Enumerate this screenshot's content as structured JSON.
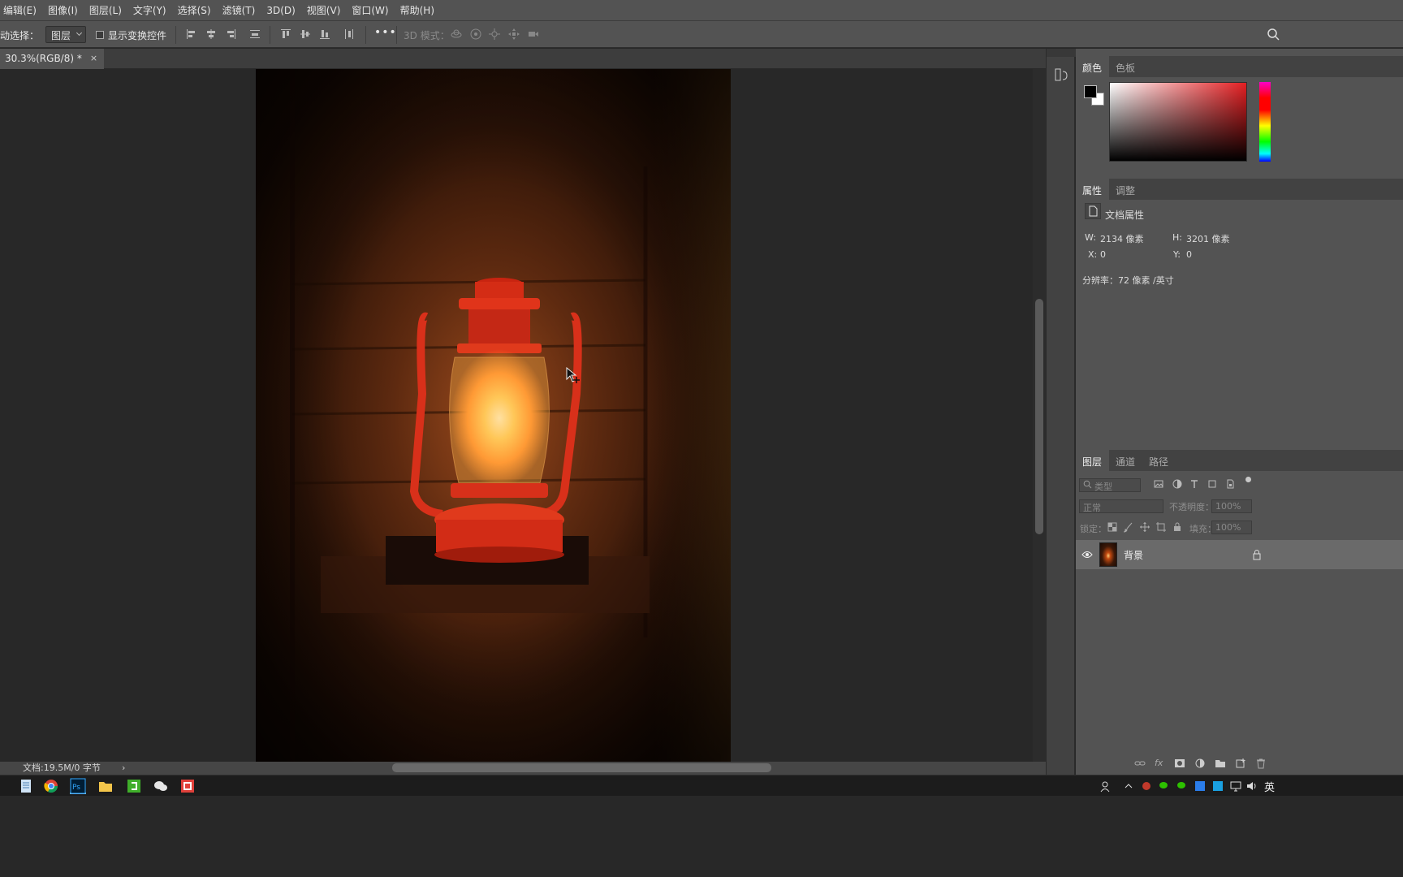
{
  "menu": [
    "编辑(E)",
    "图像(I)",
    "图层(L)",
    "文字(Y)",
    "选择(S)",
    "滤镜(T)",
    "3D(D)",
    "视图(V)",
    "窗口(W)",
    "帮助(H)"
  ],
  "options": {
    "auto_select_label": "动选择：",
    "auto_select_value": "图层",
    "transform_controls_label": "显示变换控件",
    "more": "•••",
    "mode_3d_label": "3D 模式："
  },
  "document_tab": {
    "title": "30.3%(RGB/8) *",
    "close": "×"
  },
  "status": {
    "doc_size": "文档:19.5M/0 字节",
    "arrow": "›"
  },
  "panels": {
    "color": {
      "tabs": [
        "颜色",
        "色板"
      ],
      "foreground": "#000000",
      "background": "#ffffff",
      "hue": "#e41f22"
    },
    "properties": {
      "tabs": [
        "属性",
        "调整"
      ],
      "section_title": "文档属性",
      "w_label": "W:",
      "w_value": "2134 像素",
      "h_label": "H:",
      "h_value": "3201 像素",
      "x_label": "X:",
      "x_value": "0",
      "y_label": "Y:",
      "y_value": "0",
      "resolution": "分辨率：72 像素 /英寸"
    },
    "layers": {
      "tabs": [
        "图层",
        "通道",
        "路径"
      ],
      "filter_placeholder": "类型",
      "blend_mode": "正常",
      "opacity_label": "不透明度：",
      "opacity_value": "100%",
      "lock_label": "锁定：",
      "fill_label": "填充：",
      "fill_value": "100%",
      "items": [
        {
          "name": "背景",
          "visible": true,
          "locked": true
        }
      ]
    }
  },
  "taskbar": {
    "ime": "英"
  }
}
